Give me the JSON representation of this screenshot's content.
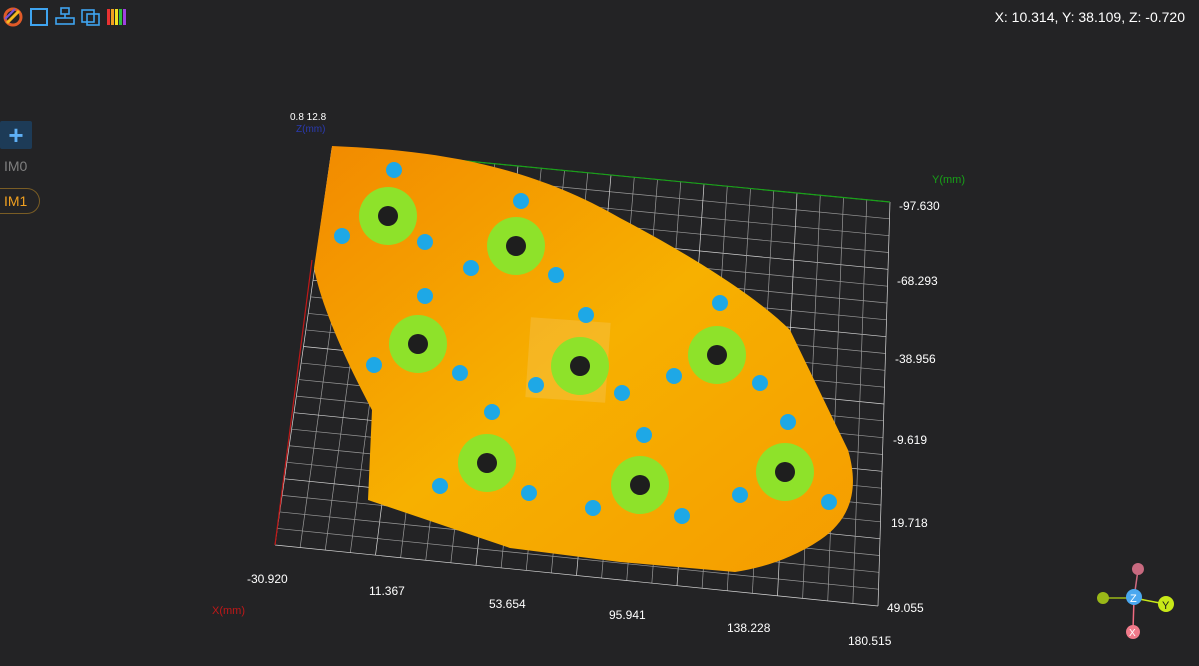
{
  "toolbar": {
    "icons": [
      "logo-icon",
      "box-select-icon",
      "align-icon",
      "layers-icon",
      "color-bar-icon"
    ]
  },
  "coordinates_readout": "X: 10.314, Y: 38.109, Z: -0.720",
  "sidebar": {
    "add_label": "+",
    "items": [
      {
        "label": "IM0",
        "active": false
      },
      {
        "label": "IM1",
        "active": true
      }
    ]
  },
  "scene": {
    "x_axis": {
      "label": "X(mm)",
      "ticks": [
        "-30.920",
        "11.367",
        "53.654",
        "95.941",
        "138.228",
        "180.515"
      ]
    },
    "y_axis": {
      "label": "Y(mm)",
      "ticks": [
        "-97.630",
        "-68.293",
        "-38.956",
        "-9.619",
        "19.718",
        "49.055"
      ]
    },
    "z_axis": {
      "label": "Z(mm)"
    },
    "colors": {
      "background": "#232325",
      "part_orange": "#f5a000",
      "ring_green": "#8ee22a",
      "hole_blue": "#1ea8e6",
      "x_axis_line": "#c01818",
      "y_axis_line": "#18a018"
    }
  },
  "gizmo": {
    "x": "X",
    "y": "Y",
    "z": "Z"
  }
}
